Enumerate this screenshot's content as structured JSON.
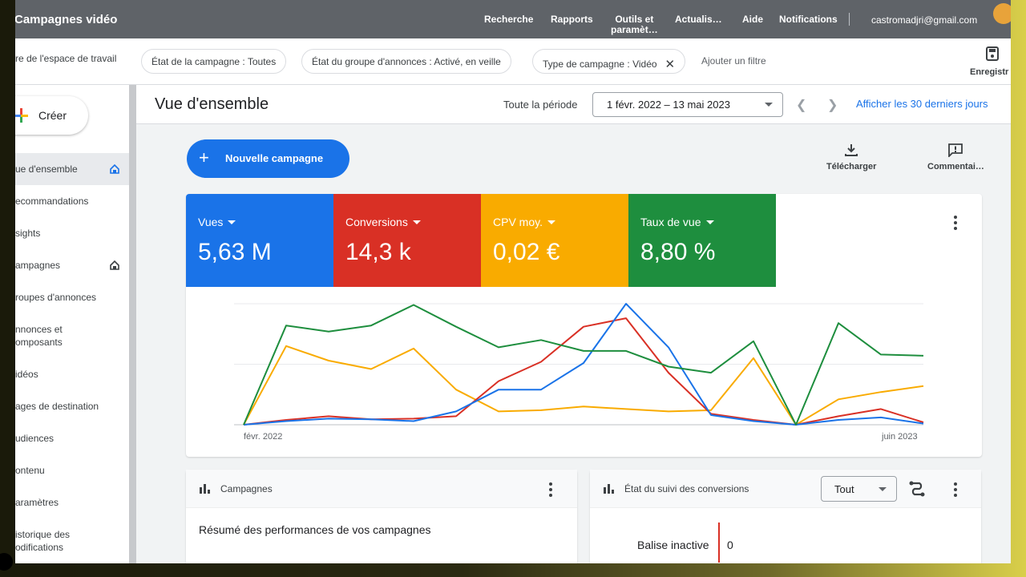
{
  "app": {
    "title": "Campagnes vidéo"
  },
  "topnav": [
    {
      "label": "Recherche"
    },
    {
      "label": "Rapports"
    },
    {
      "label": "Outils et\nparamèt…"
    },
    {
      "label": "Actualis…"
    },
    {
      "label": "Aide"
    },
    {
      "label": "Notifications"
    }
  ],
  "account": {
    "email": "castromadjri@gmail.com"
  },
  "filterbar": {
    "workspace": "re de l'espace de travail",
    "chips": [
      {
        "label": "État de la campagne : Toutes"
      },
      {
        "label": "État du groupe d'annonces : Activé, en veille"
      },
      {
        "label": "Type de campagne : Vidéo",
        "removable": true
      }
    ],
    "add_filter": "Ajouter un filtre",
    "save_label": "Enregistr",
    "save_icon": "save-icon"
  },
  "sidebar": {
    "create_label": "Créer",
    "items": [
      {
        "label": "ue d'ensemble",
        "active": true,
        "home": true
      },
      {
        "label": "ecommandations"
      },
      {
        "label": "sights"
      },
      {
        "label": "ampagnes",
        "home": true
      },
      {
        "label": "roupes d'annonces"
      },
      {
        "label": "nnonces et\nomposants"
      },
      {
        "label": "idéos"
      },
      {
        "label": "ages de destination"
      },
      {
        "label": "udiences"
      },
      {
        "label": "ontenu"
      },
      {
        "label": "aramètres"
      },
      {
        "label": "istorique des\nodifications"
      }
    ]
  },
  "header": {
    "title": "Vue d'ensemble",
    "period_label": "Toute la période",
    "date_range": "1 févr. 2022 – 13 mai 2023",
    "last_30": "Afficher les 30 derniers jours"
  },
  "toolbar": {
    "new_campaign": "Nouvelle campagne",
    "download": "Télécharger",
    "feedback": "Commentai…"
  },
  "metrics": [
    {
      "label": "Vues",
      "value": "5,63 M",
      "color": "#1a73e8"
    },
    {
      "label": "Conversions",
      "value": "14,3 k",
      "color": "#d93025"
    },
    {
      "label": "CPV moy.",
      "value": "0,02 €",
      "color": "#f9ab00"
    },
    {
      "label": "Taux de vue",
      "value": "8,80 %",
      "color": "#1e8e3e"
    }
  ],
  "chart_data": {
    "type": "line",
    "x_start_label": "févr. 2022",
    "x_end_label": "juin 2023",
    "ylim": [
      0,
      100
    ],
    "grid": true,
    "series": [
      {
        "name": "Vues",
        "color": "#1a73e8",
        "values": [
          0,
          3,
          5,
          4.5,
          3,
          11,
          29,
          29,
          51,
          100,
          64,
          8,
          3,
          0,
          4,
          6,
          1
        ]
      },
      {
        "name": "Conversions",
        "color": "#d93025",
        "values": [
          0,
          4,
          7,
          4.5,
          5,
          7,
          36,
          52,
          81,
          88,
          43,
          9,
          4,
          0,
          7,
          13,
          2
        ]
      },
      {
        "name": "CPV moy.",
        "color": "#f9ab00",
        "values": [
          0,
          65,
          53,
          46,
          63,
          29,
          11,
          12,
          15,
          13,
          11,
          12,
          55,
          0,
          21,
          27,
          32
        ]
      },
      {
        "name": "Taux de vue",
        "color": "#1e8e3e",
        "values": [
          0,
          82,
          77,
          82,
          99,
          81,
          64,
          70,
          61,
          61,
          48,
          43,
          69,
          0,
          84,
          58,
          57
        ]
      }
    ]
  },
  "cards": {
    "campaigns": {
      "title": "Campagnes",
      "summary": "Résumé des performances de vos campagnes"
    },
    "conversions": {
      "title": "État du suivi des conversions",
      "filter": "Tout",
      "inactive_label": "Balise inactive",
      "inactive_value": "0"
    }
  }
}
